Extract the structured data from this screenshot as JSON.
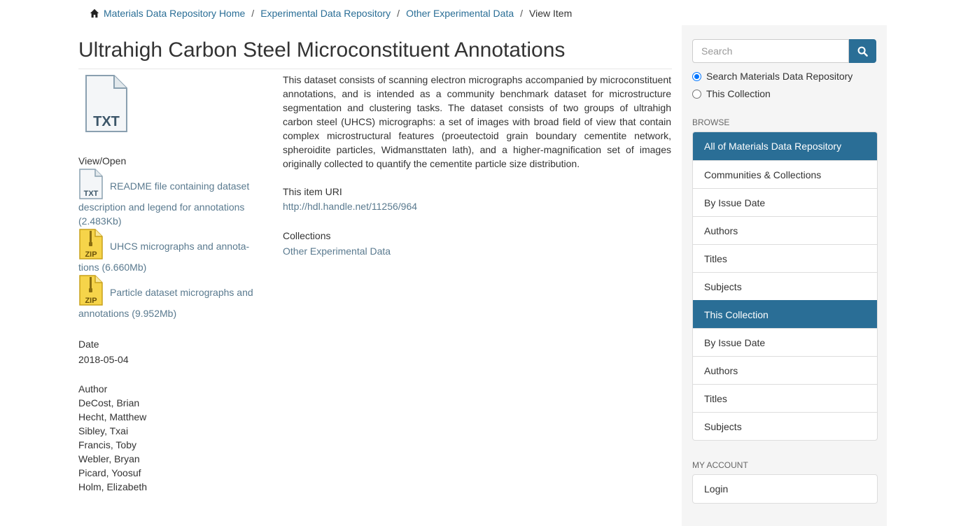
{
  "breadcrumb": {
    "home": "Materials Data Repository Home",
    "level1": "Experimental Data Repository",
    "level2": "Other Experimental Data",
    "current": "View Item",
    "separator": "/"
  },
  "item": {
    "title": "Ultrahigh Carbon Steel Microconstituent Annotations",
    "thumbnail_label": "TXT",
    "view_open_label": "View/Open",
    "files": [
      {
        "icon": "TXT",
        "name_line1": "README file containing dataset",
        "name_line2": "description and legend for annotations",
        "size": "(2.483Kb)"
      },
      {
        "icon": "ZIP",
        "name_line1": "UHCS micrographs and annota-",
        "name_line2": "tions",
        "size": "(6.660Mb)"
      },
      {
        "icon": "ZIP",
        "name_line1": "Particle dataset micrographs and",
        "name_line2": "annotations",
        "size": "(9.952Mb)"
      }
    ],
    "date_label": "Date",
    "date": "2018-05-04",
    "author_label": "Author",
    "authors": [
      "DeCost, Brian",
      "Hecht, Matthew",
      "Sibley, Txai",
      "Francis, Toby",
      "Webler, Bryan",
      "Picard, Yoosuf",
      "Holm, Elizabeth"
    ],
    "description": "This dataset consists of scanning electron micrographs accompanied by microconstituent annotations, and is intended as a community benchmark dataset for microstructure segmentation and clustering tasks. The dataset consists of two groups of ultrahigh carbon steel (UHCS) micrographs: a set of images with broad field of view that contain complex microstructural features (proeutectoid grain boundary cementite network, spheroidite particles, Widmansttaten lath), and a higher-magnification set of images originally collected to quantify the cementite particle size distribution.",
    "uri_label": "This item URI",
    "uri": "http://hdl.handle.net/11256/964",
    "collections_label": "Collections",
    "collection": "Other Experimental Data"
  },
  "sidebar": {
    "search_placeholder": "Search",
    "scope_options": [
      "Search Materials Data Repository",
      "This Collection"
    ],
    "scope_selected": "Search Materials Data Repository",
    "browse_heading": "BROWSE",
    "browse": [
      {
        "label": "All of Materials Data Repository",
        "active": true
      },
      {
        "label": "Communities & Collections",
        "active": false
      },
      {
        "label": "By Issue Date",
        "active": false
      },
      {
        "label": "Authors",
        "active": false
      },
      {
        "label": "Titles",
        "active": false
      },
      {
        "label": "Subjects",
        "active": false
      },
      {
        "label": "This Collection",
        "active": true
      },
      {
        "label": "By Issue Date",
        "active": false
      },
      {
        "label": "Authors",
        "active": false
      },
      {
        "label": "Titles",
        "active": false
      },
      {
        "label": "Subjects",
        "active": false
      }
    ],
    "account_heading": "MY ACCOUNT",
    "login": "Login"
  },
  "colors": {
    "accent": "#2a6e96",
    "link": "#5a7a8f",
    "sidebar_bg": "#f5f5f5"
  }
}
